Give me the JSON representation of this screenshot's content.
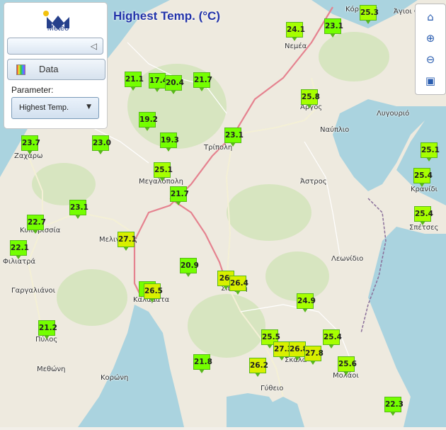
{
  "title": "Highest Temp. (°C)",
  "panel": {
    "logo_text": "Meteo",
    "data_button": "Data",
    "parameter_label": "Parameter:",
    "parameter_value": "Highest Temp."
  },
  "towns": [
    {
      "name": "Κόρινθος",
      "l": 488,
      "t": 8
    },
    {
      "name": "Άγιοι Θ.",
      "l": 556,
      "t": 11
    },
    {
      "name": "Νεμέα",
      "l": 402,
      "t": 60
    },
    {
      "name": "Άργος",
      "l": 424,
      "t": 146
    },
    {
      "name": "Λυγουριό",
      "l": 532,
      "t": 155
    },
    {
      "name": "Ναύπλιο",
      "l": 452,
      "t": 178
    },
    {
      "name": "Τρίπολη",
      "l": 288,
      "t": 203
    },
    {
      "name": "Ζαχάρω",
      "l": 20,
      "t": 215
    },
    {
      "name": "Μεγαλόπολη",
      "l": 196,
      "t": 251
    },
    {
      "name": "Άστρος",
      "l": 424,
      "t": 251
    },
    {
      "name": "Κρανίδι",
      "l": 580,
      "t": 262
    },
    {
      "name": "Σπέτσες",
      "l": 578,
      "t": 316
    },
    {
      "name": "Κυπαρισσία",
      "l": 28,
      "t": 320
    },
    {
      "name": "Μελιγαλάς",
      "l": 140,
      "t": 333
    },
    {
      "name": "Λεωνίδιο",
      "l": 468,
      "t": 360
    },
    {
      "name": "Φιλιατρά",
      "l": 4,
      "t": 364
    },
    {
      "name": "Σπάρτη",
      "l": 312,
      "t": 402
    },
    {
      "name": "Γαργαλιάνοι",
      "l": 16,
      "t": 405
    },
    {
      "name": "Καλαμάτα",
      "l": 188,
      "t": 418
    },
    {
      "name": "Πύλος",
      "l": 50,
      "t": 474
    },
    {
      "name": "Σκάλα",
      "l": 402,
      "t": 503
    },
    {
      "name": "Μεθώνη",
      "l": 52,
      "t": 516
    },
    {
      "name": "Μολάοι",
      "l": 470,
      "t": 525
    },
    {
      "name": "Κορώνη",
      "l": 142,
      "t": 528
    },
    {
      "name": "Γύθειο",
      "l": 368,
      "t": 543
    }
  ],
  "stations": [
    {
      "v": "25.3",
      "l": 508,
      "t": 7
    },
    {
      "v": "24.1",
      "l": 404,
      "t": 31
    },
    {
      "v": "23.1",
      "l": 458,
      "t": 26
    },
    {
      "v": "21.1",
      "l": 176,
      "t": 101
    },
    {
      "v": "17.4",
      "l": 210,
      "t": 103
    },
    {
      "v": "20.4",
      "l": 233,
      "t": 106
    },
    {
      "v": "21.7",
      "l": 273,
      "t": 102
    },
    {
      "v": "25.8",
      "l": 425,
      "t": 126
    },
    {
      "v": "19.2",
      "l": 196,
      "t": 158
    },
    {
      "v": "23.1",
      "l": 317,
      "t": 180
    },
    {
      "v": "19.3",
      "l": 226,
      "t": 187
    },
    {
      "v": "23.7",
      "l": 30,
      "t": 191
    },
    {
      "v": "23.0",
      "l": 130,
      "t": 191
    },
    {
      "v": "25.1",
      "l": 594,
      "t": 201
    },
    {
      "v": "25.1",
      "l": 217,
      "t": 229
    },
    {
      "v": "25.4",
      "l": 584,
      "t": 237
    },
    {
      "v": "21.7",
      "l": 240,
      "t": 263
    },
    {
      "v": "23.1",
      "l": 98,
      "t": 282
    },
    {
      "v": "25.4",
      "l": 585,
      "t": 291
    },
    {
      "v": "22.7",
      "l": 38,
      "t": 303
    },
    {
      "v": "27.1",
      "l": 166,
      "t": 327
    },
    {
      "v": "22.1",
      "l": 14,
      "t": 339
    },
    {
      "v": "20.9",
      "l": 254,
      "t": 364
    },
    {
      "v": "26.",
      "l": 307,
      "t": 382
    },
    {
      "v": "26.4",
      "l": 324,
      "t": 389
    },
    {
      "v": "2",
      "l": 196,
      "t": 397
    },
    {
      "v": "26.5",
      "l": 203,
      "t": 400
    },
    {
      "v": "24.9",
      "l": 419,
      "t": 414
    },
    {
      "v": "21.2",
      "l": 54,
      "t": 452
    },
    {
      "v": "25.5",
      "l": 369,
      "t": 465
    },
    {
      "v": "25.4",
      "l": 456,
      "t": 465
    },
    {
      "v": "27.3",
      "l": 386,
      "t": 482
    },
    {
      "v": "26.8",
      "l": 408,
      "t": 482
    },
    {
      "v": "27.8",
      "l": 430,
      "t": 488
    },
    {
      "v": "21.8",
      "l": 273,
      "t": 500
    },
    {
      "v": "25.6",
      "l": 477,
      "t": 503
    },
    {
      "v": "26.2",
      "l": 352,
      "t": 505
    },
    {
      "v": "22.3",
      "l": 543,
      "t": 560
    }
  ],
  "colors": {
    "marker_low": "#74ff00",
    "marker_mid": "#a6ff00",
    "marker_high": "#d8f000",
    "title": "#2233aa"
  },
  "controls": [
    "home-icon",
    "zoom-in-icon",
    "zoom-out-icon",
    "zoom-extent-icon"
  ]
}
